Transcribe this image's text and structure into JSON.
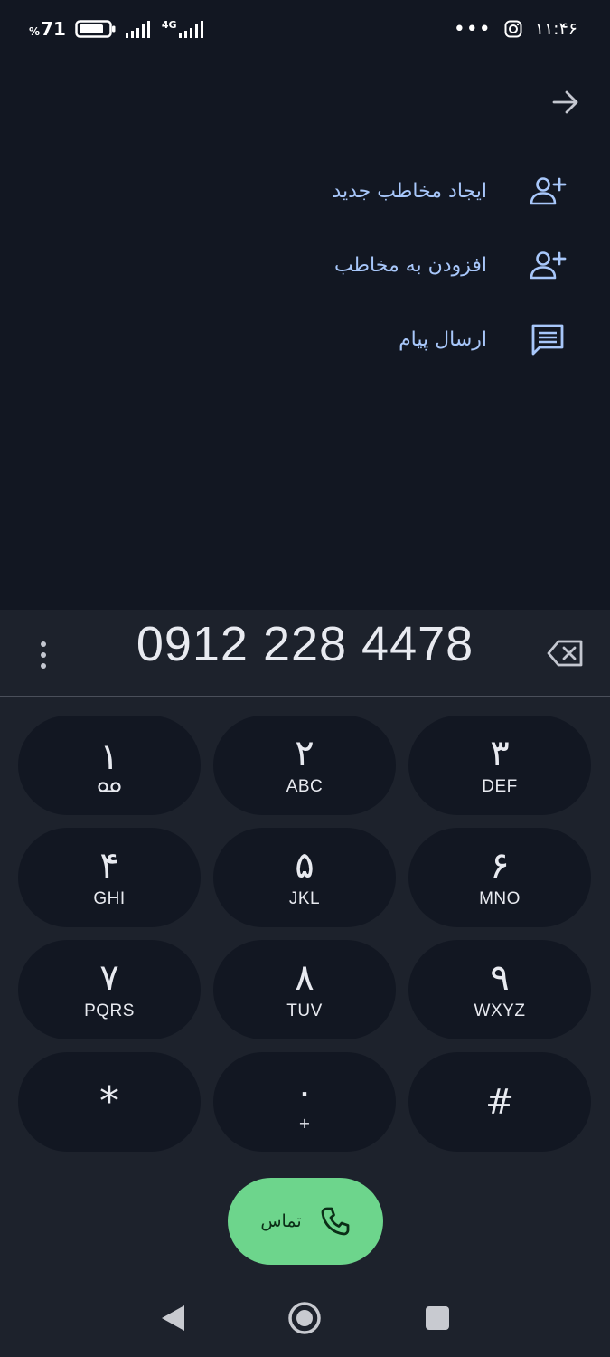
{
  "status_bar": {
    "battery_percent_sign": "%",
    "battery_level": "71",
    "network_type": "4G",
    "overflow_indicator": "•••",
    "time": "۱۱:۴۶"
  },
  "actions": [
    {
      "label": "ایجاد مخاطب جدید",
      "icon": "person-add-icon"
    },
    {
      "label": "افزودن به مخاطب",
      "icon": "person-add-icon"
    },
    {
      "label": "ارسال پیام",
      "icon": "message-icon"
    }
  ],
  "dialer": {
    "number": "0912 228 4478",
    "keys": [
      {
        "digit": "۱",
        "letters": ""
      },
      {
        "digit": "۲",
        "letters": "ABC"
      },
      {
        "digit": "۳",
        "letters": "DEF"
      },
      {
        "digit": "۴",
        "letters": "GHI"
      },
      {
        "digit": "۵",
        "letters": "JKL"
      },
      {
        "digit": "۶",
        "letters": "MNO"
      },
      {
        "digit": "۷",
        "letters": "PQRS"
      },
      {
        "digit": "۸",
        "letters": "TUV"
      },
      {
        "digit": "۹",
        "letters": "WXYZ"
      },
      {
        "digit": "*",
        "letters": ""
      },
      {
        "digit": "۰",
        "letters": "+"
      },
      {
        "digit": "#",
        "letters": ""
      }
    ],
    "call_label": "تماس"
  },
  "colors": {
    "background": "#121722",
    "dialer_panel": "#1d222c",
    "accent_text": "#a8c7fa",
    "call_button": "#6dd58c"
  }
}
